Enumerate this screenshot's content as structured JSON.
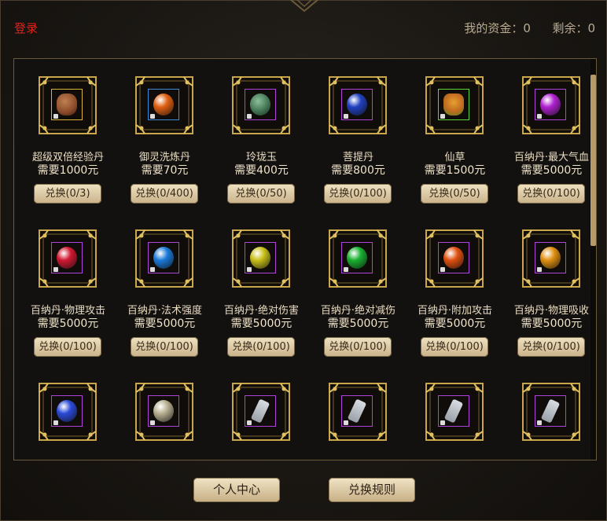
{
  "header": {
    "login_label": "登录",
    "funds_label": "我的资金：0",
    "remaining_label": "剩余：0"
  },
  "items": [
    {
      "name": "超级双倍经验丹",
      "price": "需要1000元",
      "button": "兑换(0/3)",
      "icon": "teapot-icon",
      "color": "#8a4a2a",
      "frame": "gold"
    },
    {
      "name": "御灵洗炼丹",
      "price": "需要70元",
      "button": "兑换(0/400)",
      "icon": "orange-gem-icon",
      "color": "#e06010",
      "frame": "blue"
    },
    {
      "name": "玲珑玉",
      "price": "需要400元",
      "button": "兑换(0/50)",
      "icon": "jade-dragon-icon",
      "color": "#3a6a4a",
      "frame": "purple"
    },
    {
      "name": "菩提丹",
      "price": "需要800元",
      "button": "兑换(0/100)",
      "icon": "blue-orb-icon",
      "color": "#2040c0",
      "frame": "purple"
    },
    {
      "name": "仙草",
      "price": "需要1500元",
      "button": "兑换(0/50)",
      "icon": "herb-icon",
      "color": "#c06a20",
      "frame": "green"
    },
    {
      "name": "百纳丹·最大气血",
      "price": "需要5000元",
      "button": "兑换(0/100)",
      "icon": "purple-orb-icon",
      "color": "#b020d0",
      "frame": "purple"
    },
    {
      "name": "百纳丹·物理攻击",
      "price": "需要5000元",
      "button": "兑换(0/100)",
      "icon": "red-orb-icon",
      "color": "#d01830",
      "frame": "purple"
    },
    {
      "name": "百纳丹·法术强度",
      "price": "需要5000元",
      "button": "兑换(0/100)",
      "icon": "blue-orb-icon",
      "color": "#1a7ad8",
      "frame": "purple"
    },
    {
      "name": "百纳丹·绝对伤害",
      "price": "需要5000元",
      "button": "兑换(0/100)",
      "icon": "yellow-orb-icon",
      "color": "#c8c018",
      "frame": "purple"
    },
    {
      "name": "百纳丹·绝对减伤",
      "price": "需要5000元",
      "button": "兑换(0/100)",
      "icon": "green-orb-icon",
      "color": "#18b030",
      "frame": "purple"
    },
    {
      "name": "百纳丹·附加攻击",
      "price": "需要5000元",
      "button": "兑换(0/100)",
      "icon": "orange-orb-icon",
      "color": "#e05010",
      "frame": "purple"
    },
    {
      "name": "百纳丹·物理吸收",
      "price": "需要5000元",
      "button": "兑换(0/100)",
      "icon": "amber-orb-icon",
      "color": "#e09010",
      "frame": "purple"
    },
    {
      "name": "",
      "price": "",
      "button": "",
      "icon": "blue-orb-icon",
      "color": "#2a4ad8",
      "frame": "purple"
    },
    {
      "name": "",
      "price": "",
      "button": "",
      "icon": "crystal-icon",
      "color": "#b8b090",
      "frame": "purple"
    },
    {
      "name": "",
      "price": "",
      "button": "",
      "icon": "scroll-icon",
      "color": "#9aa0a8",
      "frame": "purple"
    },
    {
      "name": "",
      "price": "",
      "button": "",
      "icon": "scroll-icon",
      "color": "#9aa0a8",
      "frame": "purple"
    },
    {
      "name": "",
      "price": "",
      "button": "",
      "icon": "scroll-icon",
      "color": "#9aa0a8",
      "frame": "purple"
    },
    {
      "name": "",
      "price": "",
      "button": "",
      "icon": "scroll-icon",
      "color": "#9aa0a8",
      "frame": "purple"
    }
  ],
  "footer": {
    "personal_center": "个人中心",
    "exchange_rules": "兑换规则"
  },
  "colors": {
    "accent_red": "#e0221a",
    "gold_frame": "#c9a64a",
    "button_top": "#efe2c2",
    "button_bottom": "#c9b28a"
  }
}
